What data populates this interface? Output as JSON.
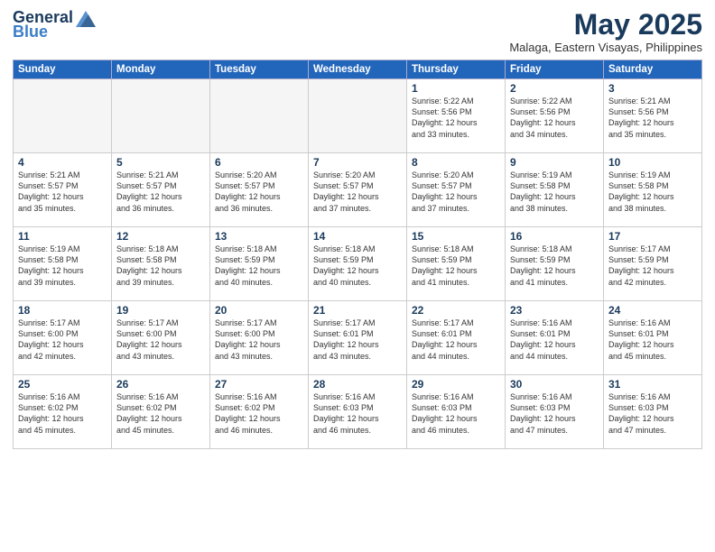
{
  "logo": {
    "line1": "General",
    "line2": "Blue"
  },
  "title": "May 2025",
  "subtitle": "Malaga, Eastern Visayas, Philippines",
  "weekdays": [
    "Sunday",
    "Monday",
    "Tuesday",
    "Wednesday",
    "Thursday",
    "Friday",
    "Saturday"
  ],
  "weeks": [
    [
      {
        "day": "",
        "info": ""
      },
      {
        "day": "",
        "info": ""
      },
      {
        "day": "",
        "info": ""
      },
      {
        "day": "",
        "info": ""
      },
      {
        "day": "1",
        "info": "Sunrise: 5:22 AM\nSunset: 5:56 PM\nDaylight: 12 hours\nand 33 minutes."
      },
      {
        "day": "2",
        "info": "Sunrise: 5:22 AM\nSunset: 5:56 PM\nDaylight: 12 hours\nand 34 minutes."
      },
      {
        "day": "3",
        "info": "Sunrise: 5:21 AM\nSunset: 5:56 PM\nDaylight: 12 hours\nand 35 minutes."
      }
    ],
    [
      {
        "day": "4",
        "info": "Sunrise: 5:21 AM\nSunset: 5:57 PM\nDaylight: 12 hours\nand 35 minutes."
      },
      {
        "day": "5",
        "info": "Sunrise: 5:21 AM\nSunset: 5:57 PM\nDaylight: 12 hours\nand 36 minutes."
      },
      {
        "day": "6",
        "info": "Sunrise: 5:20 AM\nSunset: 5:57 PM\nDaylight: 12 hours\nand 36 minutes."
      },
      {
        "day": "7",
        "info": "Sunrise: 5:20 AM\nSunset: 5:57 PM\nDaylight: 12 hours\nand 37 minutes."
      },
      {
        "day": "8",
        "info": "Sunrise: 5:20 AM\nSunset: 5:57 PM\nDaylight: 12 hours\nand 37 minutes."
      },
      {
        "day": "9",
        "info": "Sunrise: 5:19 AM\nSunset: 5:58 PM\nDaylight: 12 hours\nand 38 minutes."
      },
      {
        "day": "10",
        "info": "Sunrise: 5:19 AM\nSunset: 5:58 PM\nDaylight: 12 hours\nand 38 minutes."
      }
    ],
    [
      {
        "day": "11",
        "info": "Sunrise: 5:19 AM\nSunset: 5:58 PM\nDaylight: 12 hours\nand 39 minutes."
      },
      {
        "day": "12",
        "info": "Sunrise: 5:18 AM\nSunset: 5:58 PM\nDaylight: 12 hours\nand 39 minutes."
      },
      {
        "day": "13",
        "info": "Sunrise: 5:18 AM\nSunset: 5:59 PM\nDaylight: 12 hours\nand 40 minutes."
      },
      {
        "day": "14",
        "info": "Sunrise: 5:18 AM\nSunset: 5:59 PM\nDaylight: 12 hours\nand 40 minutes."
      },
      {
        "day": "15",
        "info": "Sunrise: 5:18 AM\nSunset: 5:59 PM\nDaylight: 12 hours\nand 41 minutes."
      },
      {
        "day": "16",
        "info": "Sunrise: 5:18 AM\nSunset: 5:59 PM\nDaylight: 12 hours\nand 41 minutes."
      },
      {
        "day": "17",
        "info": "Sunrise: 5:17 AM\nSunset: 5:59 PM\nDaylight: 12 hours\nand 42 minutes."
      }
    ],
    [
      {
        "day": "18",
        "info": "Sunrise: 5:17 AM\nSunset: 6:00 PM\nDaylight: 12 hours\nand 42 minutes."
      },
      {
        "day": "19",
        "info": "Sunrise: 5:17 AM\nSunset: 6:00 PM\nDaylight: 12 hours\nand 43 minutes."
      },
      {
        "day": "20",
        "info": "Sunrise: 5:17 AM\nSunset: 6:00 PM\nDaylight: 12 hours\nand 43 minutes."
      },
      {
        "day": "21",
        "info": "Sunrise: 5:17 AM\nSunset: 6:01 PM\nDaylight: 12 hours\nand 43 minutes."
      },
      {
        "day": "22",
        "info": "Sunrise: 5:17 AM\nSunset: 6:01 PM\nDaylight: 12 hours\nand 44 minutes."
      },
      {
        "day": "23",
        "info": "Sunrise: 5:16 AM\nSunset: 6:01 PM\nDaylight: 12 hours\nand 44 minutes."
      },
      {
        "day": "24",
        "info": "Sunrise: 5:16 AM\nSunset: 6:01 PM\nDaylight: 12 hours\nand 45 minutes."
      }
    ],
    [
      {
        "day": "25",
        "info": "Sunrise: 5:16 AM\nSunset: 6:02 PM\nDaylight: 12 hours\nand 45 minutes."
      },
      {
        "day": "26",
        "info": "Sunrise: 5:16 AM\nSunset: 6:02 PM\nDaylight: 12 hours\nand 45 minutes."
      },
      {
        "day": "27",
        "info": "Sunrise: 5:16 AM\nSunset: 6:02 PM\nDaylight: 12 hours\nand 46 minutes."
      },
      {
        "day": "28",
        "info": "Sunrise: 5:16 AM\nSunset: 6:03 PM\nDaylight: 12 hours\nand 46 minutes."
      },
      {
        "day": "29",
        "info": "Sunrise: 5:16 AM\nSunset: 6:03 PM\nDaylight: 12 hours\nand 46 minutes."
      },
      {
        "day": "30",
        "info": "Sunrise: 5:16 AM\nSunset: 6:03 PM\nDaylight: 12 hours\nand 47 minutes."
      },
      {
        "day": "31",
        "info": "Sunrise: 5:16 AM\nSunset: 6:03 PM\nDaylight: 12 hours\nand 47 minutes."
      }
    ]
  ]
}
